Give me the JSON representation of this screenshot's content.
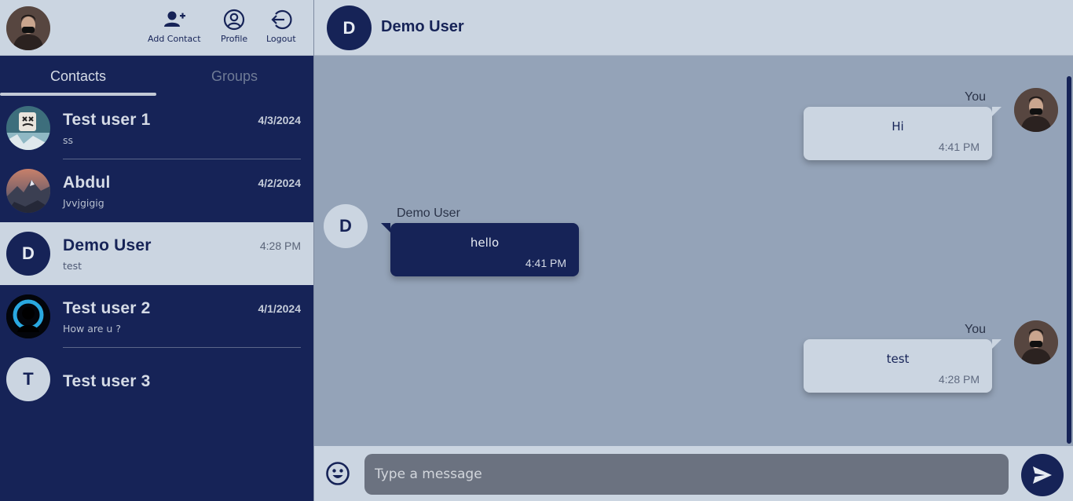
{
  "header": {
    "add_contact": "Add Contact",
    "profile": "Profile",
    "logout": "Logout"
  },
  "tabs": {
    "contacts": "Contacts",
    "groups": "Groups"
  },
  "contacts": [
    {
      "name": "Test user 1",
      "preview": "ss",
      "date": "4/3/2024",
      "avatar": "marshmello-photo"
    },
    {
      "name": "Abdul",
      "preview": "Jvvjgigig",
      "date": "4/2/2024",
      "avatar": "mountain-photo"
    },
    {
      "name": "Demo User",
      "preview": "test",
      "date": "4:28 PM",
      "avatar_letter": "D",
      "selected": true
    },
    {
      "name": "Test user 2",
      "preview": "How are u ?",
      "date": "4/1/2024",
      "avatar": "silhouette-photo"
    },
    {
      "name": "Test user 3",
      "preview": "",
      "date": "",
      "avatar_letter": "T"
    }
  ],
  "chat": {
    "name": "Demo User",
    "avatar_letter": "D",
    "messages": [
      {
        "sender": "You",
        "text": "Hi",
        "time": "4:41 PM",
        "direction": "out"
      },
      {
        "sender": "Demo User",
        "text": "hello",
        "time": "4:41 PM",
        "direction": "in",
        "avatar_letter": "D"
      },
      {
        "sender": "You",
        "text": "test",
        "time": "4:28 PM",
        "direction": "out"
      }
    ]
  },
  "composer": {
    "placeholder": "Type a message"
  },
  "colors": {
    "navy": "#162357",
    "light": "#cbd5e1",
    "chat_bg": "#94a3b8",
    "input_bg": "#6b7280"
  }
}
